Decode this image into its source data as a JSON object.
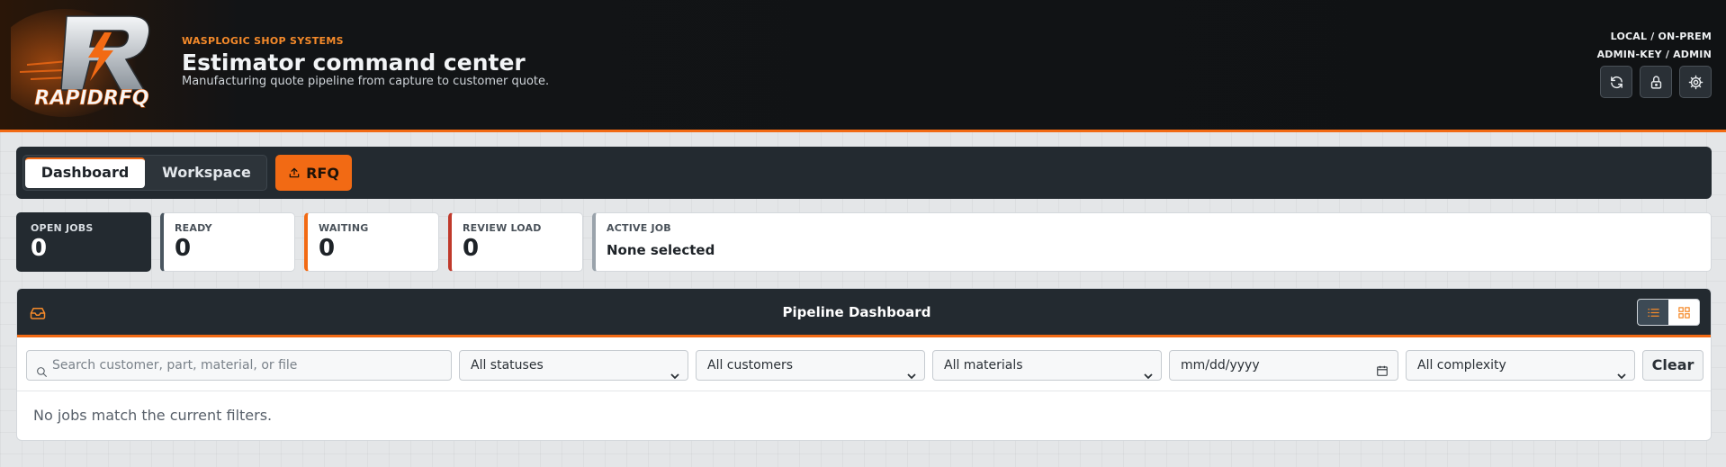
{
  "header": {
    "company": "WASPLOGIC SHOP SYSTEMS",
    "title": "Estimator command center",
    "subtitle": "Manufacturing quote pipeline from capture to customer quote.",
    "logo_text": "RAPIDRFQ",
    "deployment": "LOCAL / ON-PREM",
    "user": "ADMIN-KEY / ADMIN",
    "icons": [
      "refresh-icon",
      "lock-icon",
      "gear-icon"
    ]
  },
  "tabs": {
    "dashboard": "Dashboard",
    "workspace": "Workspace",
    "rfq": "RFQ",
    "active": "Dashboard"
  },
  "stats": {
    "open_jobs": {
      "label": "OPEN JOBS",
      "value": "0"
    },
    "ready": {
      "label": "READY",
      "value": "0"
    },
    "waiting": {
      "label": "WAITING",
      "value": "0"
    },
    "review_load": {
      "label": "REVIEW LOAD",
      "value": "0"
    },
    "active_job": {
      "label": "ACTIVE JOB",
      "value": "None selected"
    }
  },
  "pipeline": {
    "title": "Pipeline Dashboard",
    "view_mode": "list",
    "search_placeholder": "Search customer, part, material, or file",
    "status_filter": "All statuses",
    "customer_filter": "All customers",
    "material_filter": "All materials",
    "date_placeholder": "mm/dd/yyyy",
    "complexity_filter": "All complexity",
    "clear_label": "Clear",
    "empty_message": "No jobs match the current filters."
  },
  "colors": {
    "accent": "#f26a14",
    "dark": "#232a30",
    "ready_border": "#4a5660",
    "waiting_border": "#f26a14",
    "review_border": "#c0392b",
    "active_border": "#9aa3ab"
  }
}
